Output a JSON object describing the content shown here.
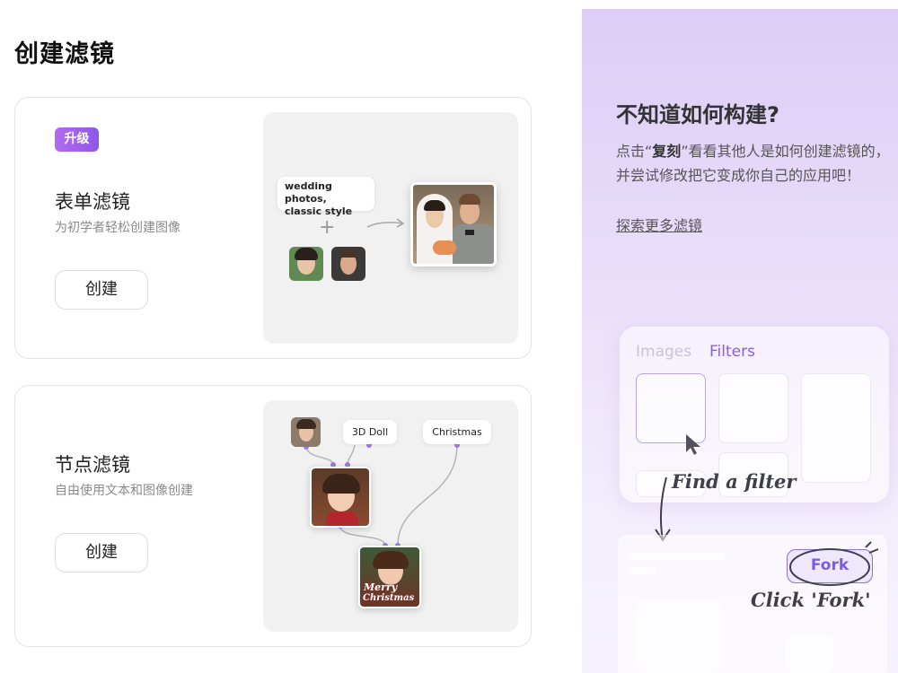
{
  "page": {
    "title": "创建滤镜"
  },
  "form_card": {
    "badge": "升级",
    "title": "表单滤镜",
    "description": "为初学者轻松创建图像",
    "button": "创建",
    "prompt_line1": "wedding photos,",
    "prompt_line2": "classic style",
    "plus": "+"
  },
  "node_card": {
    "title": "节点滤镜",
    "description": "自由使用文本和图像创建",
    "button": "创建",
    "node_label_1": "3D Doll",
    "node_label_2": "Christmas",
    "merry": "Merry",
    "christmas_text": "Christmas"
  },
  "side_panel": {
    "title": "不知道如何构建?",
    "text_prefix": "点击“",
    "text_bold": "复刻",
    "text_suffix": "”看看其他人是如何创建滤镜的，并尝试修改把它变成你自己的应用吧！",
    "link": "探索更多滤镜",
    "tab_images": "Images",
    "tab_filters": "Filters",
    "find_caption": "Find a filter",
    "fork_button": "Fork",
    "click_caption": "Click 'Fork'"
  },
  "colors": {
    "accent": "#8e57e8",
    "filters_tab": "#8a5ce6",
    "link": "#555555"
  }
}
